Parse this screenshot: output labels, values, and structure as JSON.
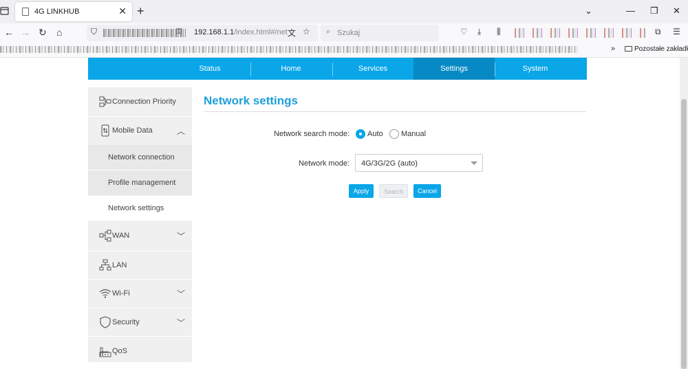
{
  "browser": {
    "tab_title": "4G LINKHUB",
    "url_host": "192.168.1.1",
    "url_path": "/index.html#/net",
    "search_placeholder": "Szukaj",
    "bookmarks_other": "Pozostałe zakładki"
  },
  "topnav": {
    "items": [
      {
        "label": "Status"
      },
      {
        "label": "Home"
      },
      {
        "label": "Services"
      },
      {
        "label": "Settings"
      },
      {
        "label": "System"
      }
    ],
    "active_index": 3
  },
  "sidebar": {
    "items": [
      {
        "label": "Connection Priority",
        "icon": "connection-priority-icon"
      },
      {
        "label": "Mobile Data",
        "icon": "mobile-data-icon",
        "expanded": true,
        "children": [
          {
            "label": "Network connection"
          },
          {
            "label": "Profile management"
          },
          {
            "label": "Network settings",
            "active": true
          }
        ]
      },
      {
        "label": "WAN",
        "icon": "wan-icon"
      },
      {
        "label": "LAN",
        "icon": "lan-icon"
      },
      {
        "label": "Wi-Fi",
        "icon": "wifi-icon"
      },
      {
        "label": "Security",
        "icon": "shield-icon"
      },
      {
        "label": "QoS",
        "icon": "qos-icon"
      }
    ]
  },
  "main": {
    "title": "Network settings",
    "search_mode_label": "Network search mode:",
    "search_mode_options": [
      "Auto",
      "Manual"
    ],
    "search_mode_selected": "Auto",
    "network_mode_label": "Network mode:",
    "network_mode_value": "4G/3G/2G (auto)",
    "buttons": {
      "apply": "Apply",
      "search": "Search",
      "cancel": "Cancel"
    }
  },
  "colors": {
    "accent": "#0aa6e8",
    "active_nav": "#0689c4",
    "title": "#1e9fd8"
  }
}
